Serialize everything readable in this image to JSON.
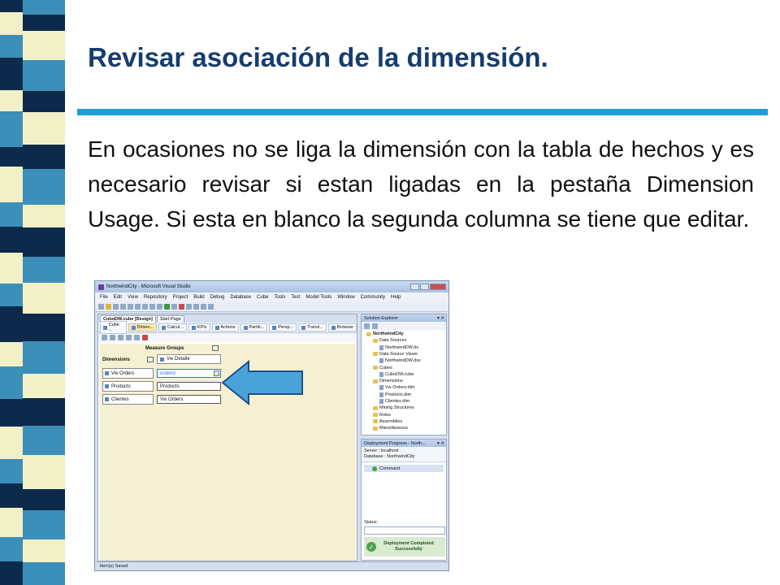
{
  "slide": {
    "title": "Revisar asociación de la dimensión.",
    "body": "En ocasiones no se liga la dimensión con la tabla de hechos y es necesario revisar si estan ligadas en la pestaña Dimension Usage. Si esta en blanco la segunda columna se tiene que editar."
  },
  "colors": {
    "title": "#173d6e",
    "rule": "#1e9cd8",
    "stripe_dark": "#0e2a4a",
    "stripe_blue": "#3b8fb8",
    "stripe_cream": "#f2f0c6",
    "arrow_fill": "#4aa3d8"
  },
  "window": {
    "title": "NorthwindCity - Microsoft Visual Studio",
    "menu": [
      "File",
      "Edit",
      "View",
      "Repository",
      "Project",
      "Build",
      "Debug",
      "Database",
      "Cube",
      "Tools",
      "Test",
      "Model Tools",
      "Window",
      "Community",
      "Help"
    ],
    "doc_tabs": [
      "CuboDW.cube [Design]",
      "Start Page"
    ],
    "designer_tabs": [
      "Cube ...",
      "Dimen...",
      "Calcul...",
      "KPIs",
      "Actions",
      "Partiti...",
      "Persp...",
      "Transl...",
      "Browser"
    ],
    "measure_groups_header": "Measure Groups",
    "dimensions_header": "Dimensions",
    "measure_group": "Vw Detalle",
    "dimensions": [
      "Vw Orders",
      "Products",
      "Clientes"
    ],
    "cells": [
      "orderid",
      "Products",
      "Vw Orders"
    ],
    "status": "Item(s) Saved"
  },
  "solution_explorer": {
    "title": "Solution Explorer",
    "nodes": [
      "NorthwindCity",
      "Data Sources",
      "NorthwindDW.ds",
      "Data Source Views",
      "NorthwindDW.dsv",
      "Cubes",
      "CuboDW.cube",
      "Dimensions",
      "Vw Orders.dim",
      "Products.dim",
      "Clientes.dim",
      "Mining Structures",
      "Roles",
      "Assemblies",
      "Miscellaneous"
    ]
  },
  "deployment": {
    "title": "Deployment Progress - North...",
    "server": "Server : localhost",
    "database": "Database : NorthwindCity",
    "command": "Command",
    "status_label": "Status:",
    "done_line1": "Deployment Completed",
    "done_line2": "Successfully"
  }
}
